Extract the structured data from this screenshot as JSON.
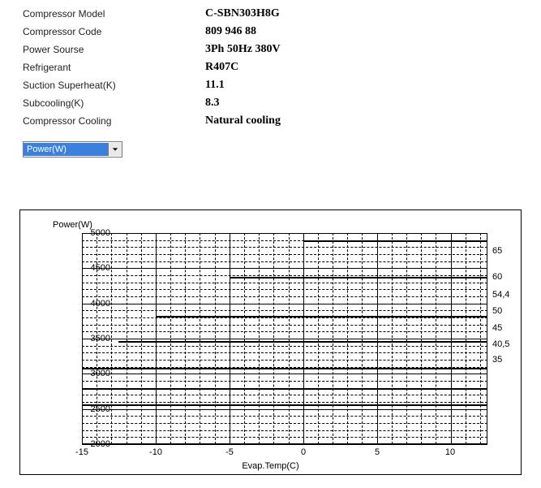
{
  "specs": {
    "rows": [
      {
        "label": "Compressor Model",
        "value": "C-SBN303H8G"
      },
      {
        "label": "Compressor Code",
        "value": "809 946 88"
      },
      {
        "label": "Power Sourse",
        "value": "3Ph  50Hz  380V"
      },
      {
        "label": "Refrigerant",
        "value": "R407C"
      },
      {
        "label": "Suction Superheat(K)",
        "value": "11.1"
      },
      {
        "label": "Subcooling(K)",
        "value": "8.3"
      },
      {
        "label": "Compressor Cooling",
        "value": "Natural cooling"
      }
    ]
  },
  "dropdown": {
    "selected": "Power(W)"
  },
  "chart_data": {
    "type": "line",
    "title": "Power(W)",
    "xlabel": "Evap.Temp(C)",
    "ylabel": "Power(W)",
    "xlim": [
      -15,
      12.5
    ],
    "ylim": [
      2000,
      5000
    ],
    "x_ticks": [
      -15,
      -10,
      -5,
      0,
      5,
      10
    ],
    "y_ticks": [
      2000,
      2500,
      3000,
      3500,
      4000,
      4500,
      5000
    ],
    "series": [
      {
        "name": "35",
        "x": [
          -15,
          12.5
        ],
        "y": [
          2560,
          2560
        ]
      },
      {
        "name": "40,5",
        "x": [
          -15,
          12.5
        ],
        "y": [
          2800,
          2800
        ]
      },
      {
        "name": "45",
        "x": [
          -15,
          12.5
        ],
        "y": [
          3080,
          3080
        ]
      },
      {
        "name": "50",
        "x": [
          -12.5,
          12.5
        ],
        "y": [
          3440,
          3480
        ]
      },
      {
        "name": "54,4",
        "x": [
          -10,
          12.5
        ],
        "y": [
          3820,
          3820
        ]
      },
      {
        "name": "60",
        "x": [
          -5,
          12.5
        ],
        "y": [
          4380,
          4380
        ]
      },
      {
        "name": "65",
        "x": [
          0,
          12.5
        ],
        "y": [
          4900,
          4900
        ]
      }
    ],
    "right_labels": [
      "65",
      "60",
      "54,4",
      "50",
      "45",
      "40,5",
      "35"
    ]
  }
}
